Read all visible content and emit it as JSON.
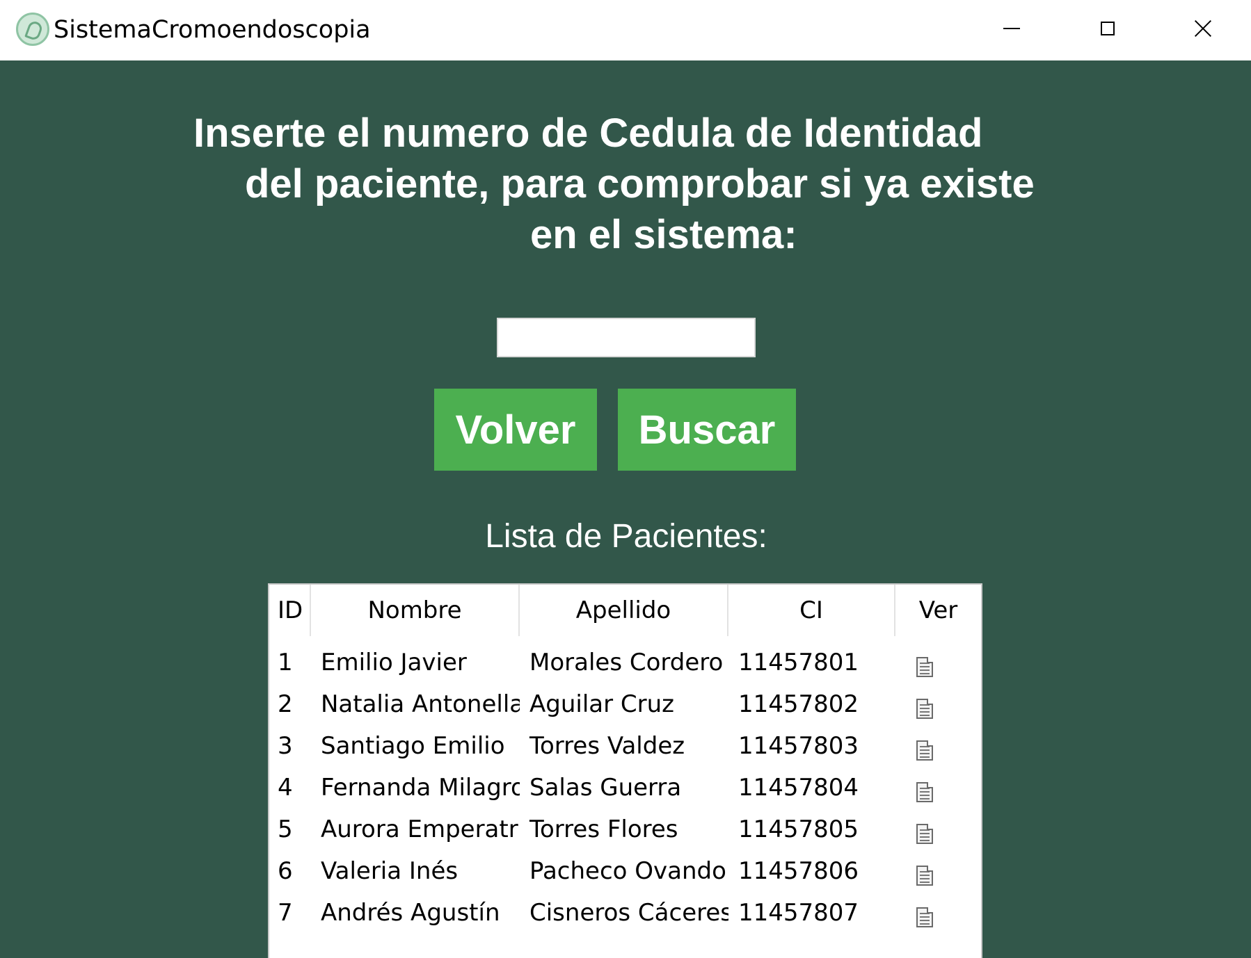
{
  "window": {
    "title": "SistemaCromoendoscopia",
    "icon": "stomach-app-icon"
  },
  "prompt": {
    "line1": "Inserte el numero de Cedula de Identidad",
    "line2": "del paciente, para comprobar si ya existe",
    "line3": "en el sistema:"
  },
  "search": {
    "value": "",
    "placeholder": ""
  },
  "buttons": {
    "back_label": "Volver",
    "search_label": "Buscar"
  },
  "list": {
    "title": "Lista de Pacientes:",
    "columns": [
      "ID",
      "Nombre",
      "Apellido",
      "CI",
      "Ver"
    ],
    "rows": [
      {
        "id": "1",
        "nombre": "Emilio Javier",
        "apellido": "Morales Cordero",
        "ci": "11457801",
        "ver": "document-icon"
      },
      {
        "id": "2",
        "nombre": "Natalia Antonella",
        "apellido": "Aguilar Cruz",
        "ci": "11457802",
        "ver": "document-icon"
      },
      {
        "id": "3",
        "nombre": "Santiago Emilio",
        "apellido": "Torres Valdez",
        "ci": "11457803",
        "ver": "document-icon"
      },
      {
        "id": "4",
        "nombre": "Fernanda Milagro",
        "apellido": "Salas Guerra",
        "ci": "11457804",
        "ver": "document-icon"
      },
      {
        "id": "5",
        "nombre": "Aurora Emperatri:",
        "apellido": "Torres Flores",
        "ci": "11457805",
        "ver": "document-icon"
      },
      {
        "id": "6",
        "nombre": "Valeria Inés",
        "apellido": "Pacheco Ovando",
        "ci": "11457806",
        "ver": "document-icon"
      },
      {
        "id": "7",
        "nombre": "Andrés Agustín",
        "apellido": "Cisneros Cáceres",
        "ci": "11457807",
        "ver": "document-icon"
      }
    ]
  },
  "colors": {
    "background": "#32574a",
    "button": "#4caf50",
    "text_light": "#ffffff"
  }
}
